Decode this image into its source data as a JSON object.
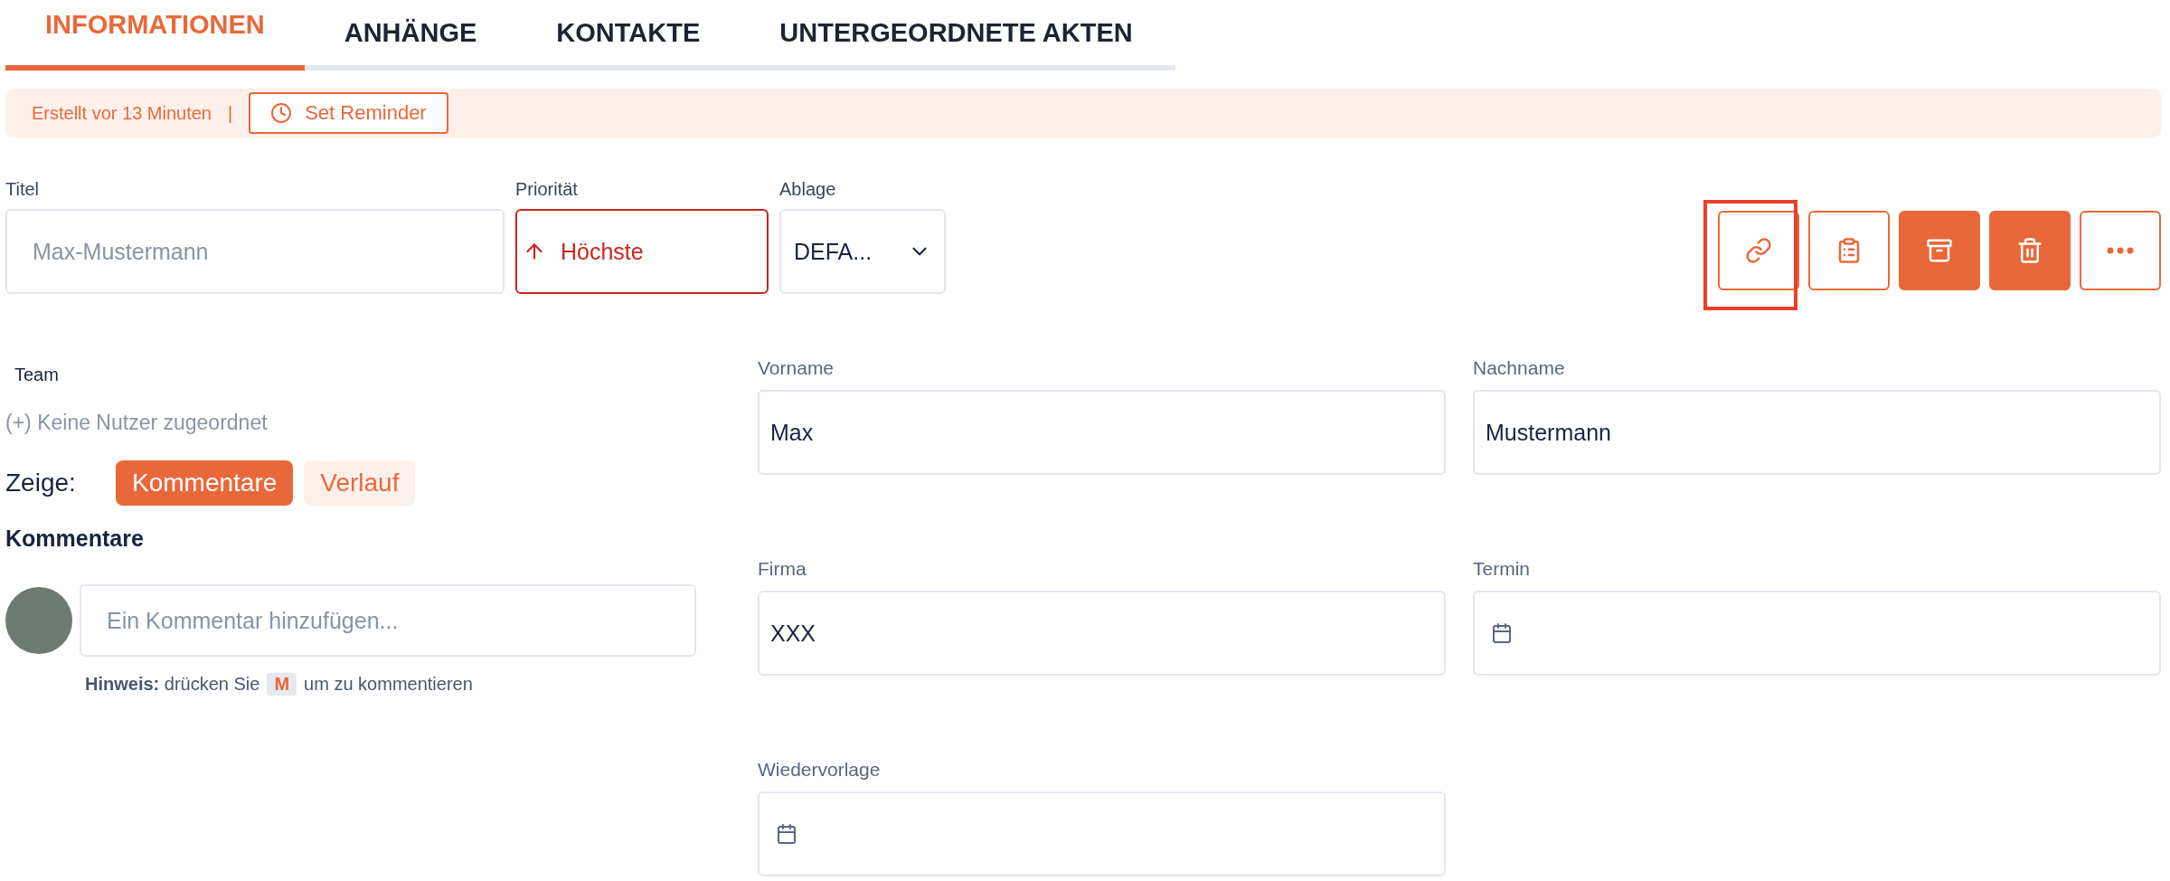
{
  "tabs": [
    {
      "label": "INFORMATIONEN",
      "selected": true
    },
    {
      "label": "ANHÄNGE",
      "selected": false
    },
    {
      "label": "KONTAKTE",
      "selected": false
    },
    {
      "label": "UNTERGEORDNETE AKTEN",
      "selected": false
    }
  ],
  "banner": {
    "created": "Erstellt vor 13 Minuten",
    "separator": "|",
    "reminder_button": "Set Reminder"
  },
  "title_field": {
    "label": "Titel",
    "placeholder": "Max-Mustermann"
  },
  "priority_field": {
    "label": "Priorität",
    "value": "Höchste"
  },
  "storage_field": {
    "label": "Ablage",
    "value": "DEFA..."
  },
  "actions": [
    {
      "kind": "link",
      "filled": false,
      "highlighted": true
    },
    {
      "kind": "clipboard",
      "filled": false,
      "highlighted": false
    },
    {
      "kind": "archive",
      "filled": true,
      "highlighted": false
    },
    {
      "kind": "trash",
      "filled": true,
      "highlighted": false
    },
    {
      "kind": "more",
      "filled": false,
      "highlighted": false
    }
  ],
  "team": {
    "label": "Team",
    "empty": "(+) Keine Nutzer zugeordnet"
  },
  "show": {
    "label": "Zeige:",
    "options": [
      {
        "label": "Kommentare",
        "selected": true
      },
      {
        "label": "Verlauf",
        "selected": false
      }
    ]
  },
  "comments": {
    "heading": "Kommentare",
    "placeholder": "Ein Kommentar hinzufügen...",
    "hint_before": "**Hinweis:** drücken Sie",
    "hint_key": "M",
    "hint_after": "um zu kommentieren"
  },
  "fields": [
    {
      "label": "Vorname",
      "kind": "text",
      "value": "Max"
    },
    {
      "label": "Nachname",
      "kind": "text",
      "value": "Mustermann"
    },
    {
      "label": "Firma",
      "kind": "text",
      "value": "XXX"
    },
    {
      "label": "Termin",
      "kind": "date"
    },
    {
      "label": "Wiedervorlage",
      "kind": "date"
    }
  ]
}
